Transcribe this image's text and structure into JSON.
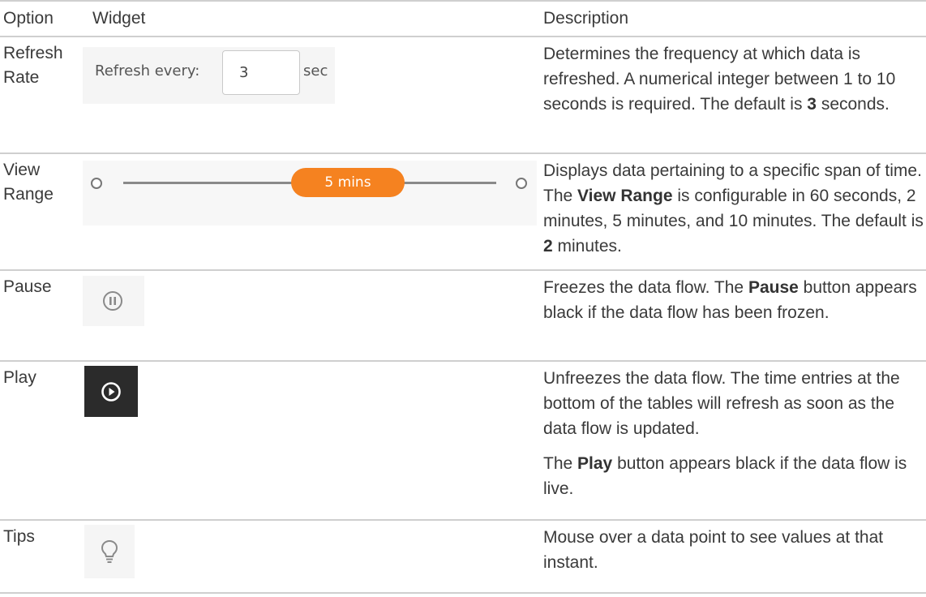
{
  "header": {
    "option": "Option",
    "widget": "Widget",
    "description": "Description"
  },
  "rows": [
    {
      "option": "Refresh Rate",
      "widget": {
        "label": "Refresh every:",
        "value": "3",
        "unit": "sec"
      },
      "description": {
        "before": "Determines the frequency at which data is refreshed. A numerical integer between 1 to 10 seconds is required. The default is ",
        "bold": "3",
        "after": " seconds."
      }
    },
    {
      "option": "View Range",
      "widget": {
        "selected": "5 mins",
        "accent": "#f58220"
      },
      "description": {
        "before": "Displays data pertaining to a specific span of time. The ",
        "bold": "View Range",
        "middle": " is configurable in 60 seconds, 2 minutes, 5 minutes, and 10 minutes. The default is ",
        "bold2": "2",
        "after": " minutes."
      }
    },
    {
      "option": "Pause",
      "widget": {
        "icon": "pause-circle-icon"
      },
      "description": {
        "before": "Freezes the data flow. The ",
        "bold": "Pause",
        "after": " button appears black if the data flow has been frozen."
      }
    },
    {
      "option": "Play",
      "widget": {
        "icon": "play-circle-icon"
      },
      "description": {
        "p1": "Unfreezes the data flow. The time entries at the bottom of the tables will refresh as soon as the data flow is updated.",
        "p2_before": "The ",
        "p2_bold": "Play",
        "p2_after": " button appears black if the data flow is live."
      }
    },
    {
      "option": "Tips",
      "widget": {
        "icon": "lightbulb-icon"
      },
      "description": {
        "before": "Mouse over a data point to see values at that instant."
      }
    }
  ]
}
